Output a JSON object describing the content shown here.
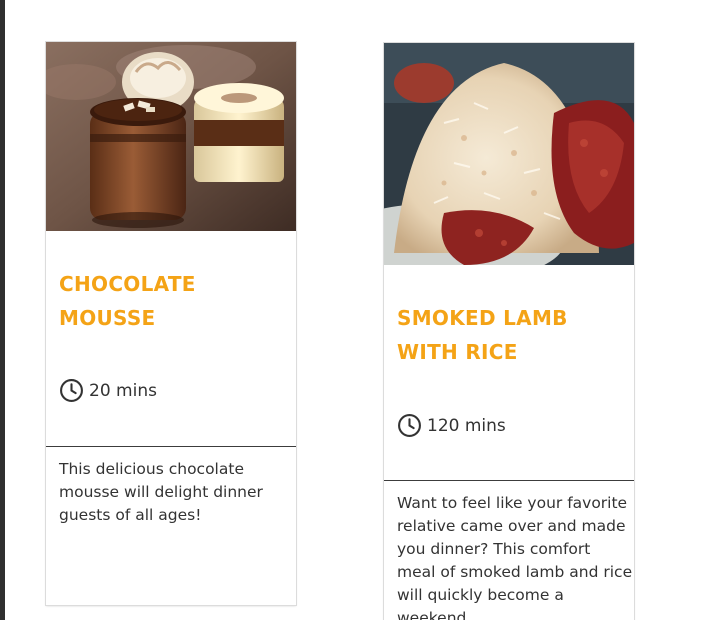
{
  "recipes": [
    {
      "title": "CHOCOLATE MOUSSE",
      "time": "20 mins",
      "description": "This delicious chocolate mousse will delight dinner guests of all ages!",
      "image_icon": "chocolate-mousse-photo"
    },
    {
      "title": "SMOKED LAMB WITH RICE",
      "time": "120 mins",
      "description": "Want to feel like your favorite relative came over and made you dinner? This comfort meal of smoked lamb and rice will quickly become a weekend",
      "image_icon": "smoked-lamb-rice-photo"
    }
  ],
  "colors": {
    "title": "#f4a316",
    "text": "#333333",
    "divider": "#3c3c3c"
  }
}
